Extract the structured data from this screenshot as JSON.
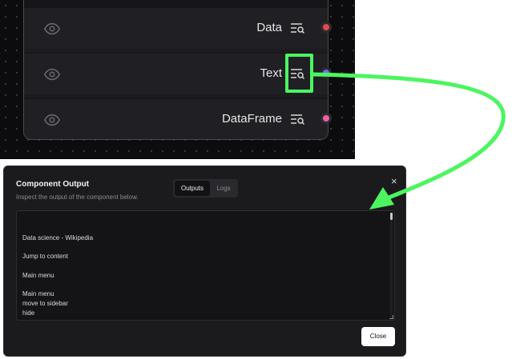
{
  "node": {
    "rows": [
      {
        "label": "Data",
        "handle_color": "#e5484d"
      },
      {
        "label": "Text",
        "handle_color": "#6b6ef9"
      },
      {
        "label": "DataFrame",
        "handle_color": "#ee5fa7"
      }
    ],
    "eye_icon": "eye-icon",
    "inspect_icon": "inspect-output-icon"
  },
  "annotation": {
    "color": "#4cf560",
    "arrow_icon": "curved-arrow-icon"
  },
  "modal": {
    "title": "Component Output",
    "description": "Inspect the output of the component below.",
    "tabs": [
      {
        "label": "Outputs",
        "active": true
      },
      {
        "label": "Logs",
        "active": false
      }
    ],
    "close_icon": "×",
    "output_lines": [
      "Data science - Wikipedia",
      "Jump to content",
      "Main menu",
      "Main menu",
      "move to sidebar",
      "hide"
    ],
    "close_label": "Close"
  }
}
